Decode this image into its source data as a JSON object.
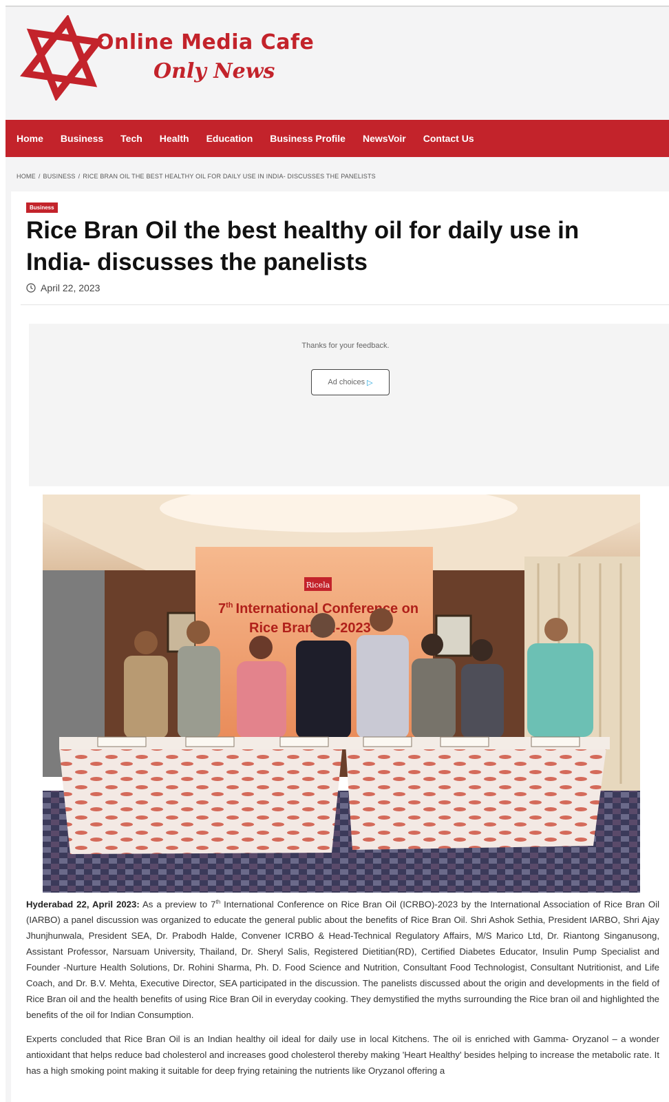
{
  "site": {
    "brand": "Online Media Cafe",
    "tagline": "Only News",
    "accent_color": "#c3232b"
  },
  "nav": {
    "items": [
      "Home",
      "Business",
      "Tech",
      "Health",
      "Education",
      "Business Profile",
      "NewsVoir",
      "Contact Us"
    ]
  },
  "breadcrumb": {
    "home": "HOME",
    "sep": "/",
    "section": "BUSINESS",
    "current": "RICE BRAN OIL THE BEST HEALTHY OIL FOR DAILY USE IN INDIA- DISCUSSES THE PANELISTS"
  },
  "article": {
    "category": "Business",
    "title": "Rice Bran Oil the best healthy oil for daily use in India- discusses the panelists",
    "date": "April 22, 2023",
    "date_icon": "clock-icon"
  },
  "ad": {
    "feedback": "Thanks for your feedback.",
    "choices_label": "Ad choices",
    "choices_icon": "ad-choices-icon"
  },
  "photo": {
    "banner_top": "7",
    "banner_sup": "th",
    "banner_main": "International Conference on",
    "banner_line2": "Rice Bran Oil-2023",
    "sponsor": "Ricela"
  },
  "body": {
    "p1_lead": "Hyderabad 22, April 2023:",
    "p1_a": " As a preview to 7",
    "p1_sup": "th",
    "p1_b": " International Conference on Rice Bran Oil (ICRBO)-2023 by the International Association of Rice Bran Oil (IARBO)  a panel discussion was organized to educate the general public about the benefits of Rice Bran Oil.  Shri Ashok Sethia, President IARBO, Shri Ajay Jhunjhunwala, President SEA, Dr. Prabodh Halde, Convener ICRBO & Head-Technical Regulatory Affairs, M/S Marico Ltd, Dr. Riantong Singanusong, Assistant Professor, Narsuam University, Thailand, Dr. Sheryl Salis, Registered Dietitian(RD), Certified Diabetes Educator, Insulin Pump Specialist and Founder -Nurture Health Solutions, Dr. Rohini Sharma, Ph. D. Food Science and Nutrition, Consultant Food Technologist, Consultant Nutritionist, and Life Coach, and Dr. B.V. Mehta, Executive Director, SEA participated in the discussion. The panelists discussed about the origin and developments in the field of Rice Bran oil and the health benefits of using Rice Bran Oil in everyday cooking. They demystified the myths surrounding the Rice bran oil and highlighted the benefits of the oil for Indian Consumption.",
    "p2": "Experts concluded that Rice Bran Oil is an Indian healthy oil ideal for daily use in local Kitchens. The oil is enriched with Gamma- Oryzanol – a wonder antioxidant that helps reduce bad cholesterol and increases good cholesterol thereby making 'Heart Healthy' besides helping to increase the metabolic rate. It has a high smoking point making it suitable for deep frying retaining the nutrients like Oryzanol offering a"
  }
}
